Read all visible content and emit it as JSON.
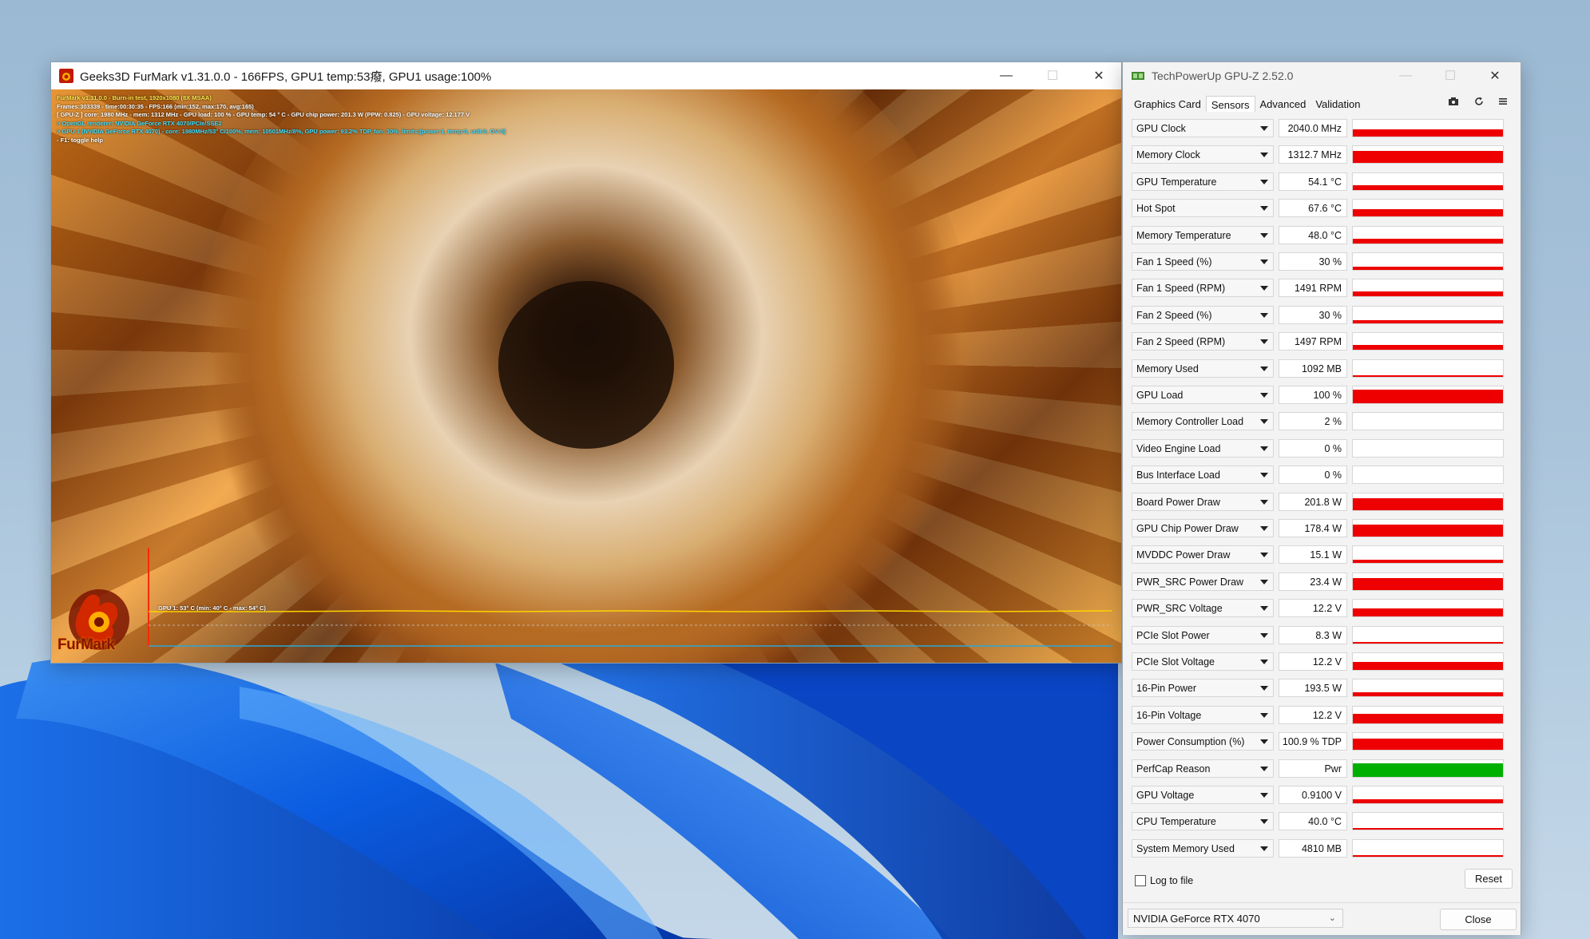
{
  "furmark": {
    "title": "Geeks3D FurMark v1.31.0.0 - 166FPS, GPU1 temp:53癈, GPU1 usage:100%",
    "hud": [
      "FurMark v1.31.0.0 - Burn-in test, 1920x1080 (8X MSAA)",
      "Frames:303339 - time:00:30:35 - FPS:166 (min:152, max:170, avg:165)",
      "[ GPU-Z ] core: 1980 MHz - mem: 1312 MHz - GPU load: 100 % - GPU temp: 54 ° C - GPU chip power: 201.3 W (PPW: 0.825) - GPU voltage: 12.177 V",
      "> OpenGL renderer: NVIDIA GeForce RTX 4070/PCIe/SSE2",
      "> GPU 1 (NVIDIA GeForce RTX 4070) - core: 1980MHz/53° C/100%, mem: 10501MHz/8%, GPU power: 93.2% TDP, fan: 30%, limits:[power:1, temp:0, volt:0, OV:0]",
      "- F1: toggle help"
    ],
    "graph_label": "GPU 1: 53° C (min: 40° C - max: 54° C)",
    "logo_text": "FurMark",
    "controls": {
      "minimize": "—",
      "maximize": "☐",
      "close": "✕"
    }
  },
  "gpuz": {
    "title": "TechPowerUp GPU-Z 2.52.0",
    "tabs": [
      "Graphics Card",
      "Sensors",
      "Advanced",
      "Validation"
    ],
    "active_tab": "Sensors",
    "sensors": [
      {
        "name": "GPU Clock",
        "value": "2040.0 MHz",
        "fill": 0.45
      },
      {
        "name": "Memory Clock",
        "value": "1312.7 MHz",
        "fill": 0.75
      },
      {
        "name": "GPU Temperature",
        "value": "54.1 °C",
        "fill": 0.3
      },
      {
        "name": "Hot Spot",
        "value": "67.6 °C",
        "fill": 0.45
      },
      {
        "name": "Memory Temperature",
        "value": "48.0 °C",
        "fill": 0.25
      },
      {
        "name": "Fan 1 Speed (%)",
        "value": "30 %",
        "fill": 0.2
      },
      {
        "name": "Fan 1 Speed (RPM)",
        "value": "1491 RPM",
        "fill": 0.3
      },
      {
        "name": "Fan 2 Speed (%)",
        "value": "30 %",
        "fill": 0.2
      },
      {
        "name": "Fan 2 Speed (RPM)",
        "value": "1497 RPM",
        "fill": 0.3
      },
      {
        "name": "Memory Used",
        "value": "1092 MB",
        "fill": 0.08
      },
      {
        "name": "GPU Load",
        "value": "100 %",
        "fill": 0.8
      },
      {
        "name": "Memory Controller Load",
        "value": "2 %",
        "fill": 0.04
      },
      {
        "name": "Video Engine Load",
        "value": "0 %",
        "fill": 0
      },
      {
        "name": "Bus Interface Load",
        "value": "0 %",
        "fill": 0
      },
      {
        "name": "Board Power Draw",
        "value": "201.8 W",
        "fill": 0.7
      },
      {
        "name": "GPU Chip Power Draw",
        "value": "178.4 W",
        "fill": 0.7
      },
      {
        "name": "MVDDC Power Draw",
        "value": "15.1 W",
        "fill": 0.2
      },
      {
        "name": "PWR_SRC Power Draw",
        "value": "23.4 W",
        "fill": 0.7
      },
      {
        "name": "PWR_SRC Voltage",
        "value": "12.2 V",
        "fill": 0.5
      },
      {
        "name": "PCIe Slot Power",
        "value": "8.3 W",
        "fill": 0.1
      },
      {
        "name": "PCIe Slot Voltage",
        "value": "12.2 V",
        "fill": 0.5
      },
      {
        "name": "16-Pin Power",
        "value": "193.5 W",
        "fill": 0.25
      },
      {
        "name": "16-Pin Voltage",
        "value": "12.2 V",
        "fill": 0.55
      },
      {
        "name": "Power Consumption (%)",
        "value": "100.9 % TDP",
        "fill": 0.7
      },
      {
        "name": "PerfCap Reason",
        "value": "Pwr",
        "fill": 0.8,
        "color": "green"
      },
      {
        "name": "GPU Voltage",
        "value": "0.9100 V",
        "fill": 0.25
      },
      {
        "name": "CPU Temperature",
        "value": "40.0 °C",
        "fill": 0.12
      },
      {
        "name": "System Memory Used",
        "value": "4810 MB",
        "fill": 0.1
      }
    ],
    "log_label": "Log to file",
    "reset_label": "Reset",
    "gpu_select": "NVIDIA GeForce RTX 4070",
    "close_label": "Close",
    "controls": {
      "minimize": "—",
      "maximize": "☐",
      "close": "✕"
    }
  },
  "colors": {
    "bar_red": "#ee0000",
    "bar_green": "#00b000"
  }
}
